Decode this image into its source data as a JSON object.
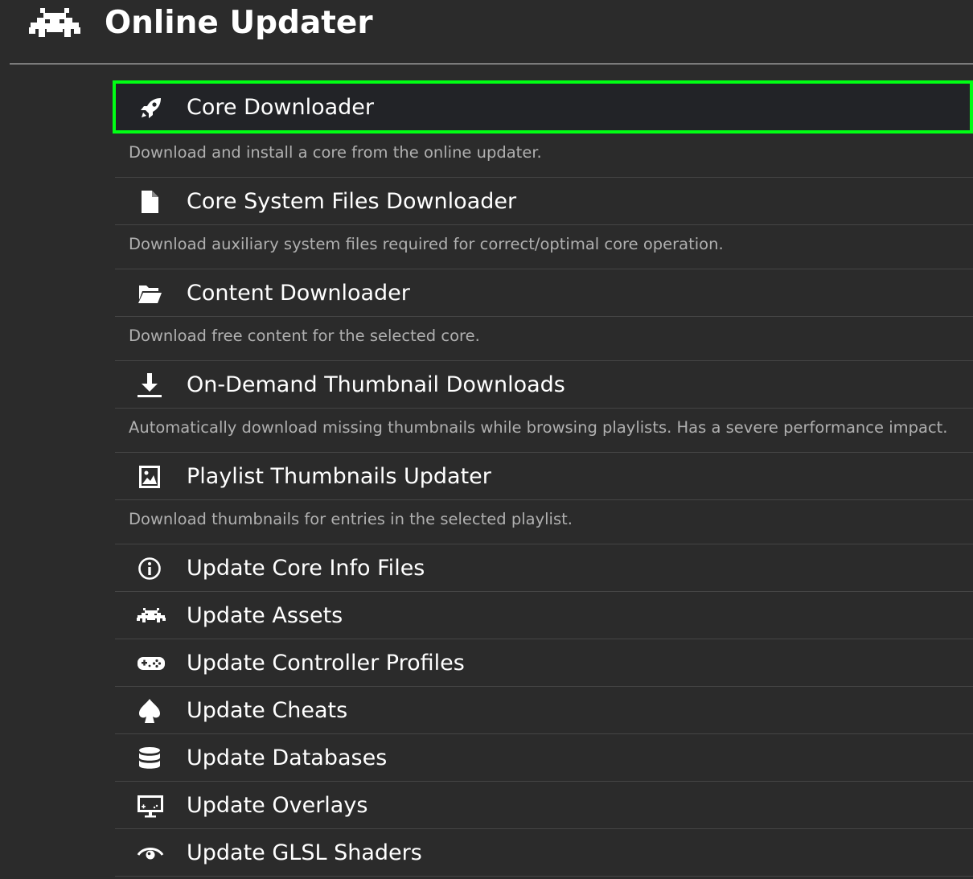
{
  "header": {
    "title": "Online Updater",
    "logo_icon": "retroarch-invader-icon"
  },
  "colors": {
    "background": "#2b2b2b",
    "selection_border": "#00ff14",
    "selection_fill": "#222327",
    "sublabel": "#b0b0b0",
    "divider": "#454545"
  },
  "menu": {
    "items": [
      {
        "label": "Core Downloader",
        "icon": "rocket-icon",
        "selected": true,
        "description": "Download and install a core from the online updater."
      },
      {
        "label": "Core System Files Downloader",
        "icon": "file-icon",
        "description": "Download auxiliary system files required for correct/optimal core operation."
      },
      {
        "label": "Content Downloader",
        "icon": "folder-open-icon",
        "description": "Download free content for the selected core."
      },
      {
        "label": "On-Demand Thumbnail Downloads",
        "icon": "download-icon",
        "description": "Automatically download missing thumbnails while browsing playlists. Has a severe performance impact."
      },
      {
        "label": "Playlist Thumbnails Updater",
        "icon": "image-icon",
        "description": "Download thumbnails for entries in the selected playlist."
      },
      {
        "label": "Update Core Info Files",
        "icon": "info-icon"
      },
      {
        "label": "Update Assets",
        "icon": "invader-icon"
      },
      {
        "label": "Update Controller Profiles",
        "icon": "gamepad-icon"
      },
      {
        "label": "Update Cheats",
        "icon": "spade-icon"
      },
      {
        "label": "Update Databases",
        "icon": "database-icon"
      },
      {
        "label": "Update Overlays",
        "icon": "monitor-overlay-icon"
      },
      {
        "label": "Update GLSL Shaders",
        "icon": "eye-icon"
      }
    ]
  }
}
